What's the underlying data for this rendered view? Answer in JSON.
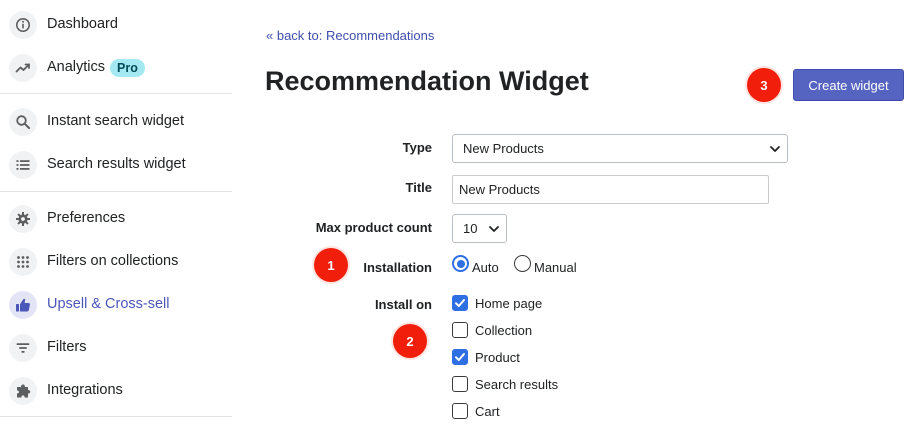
{
  "sidebar": {
    "items": [
      {
        "label": "Dashboard",
        "icon": "info-icon"
      },
      {
        "label": "Analytics",
        "icon": "trend-icon",
        "badge": "Pro"
      },
      {
        "label": "Instant search widget",
        "icon": "search-icon"
      },
      {
        "label": "Search results widget",
        "icon": "list-icon"
      },
      {
        "label": "Preferences",
        "icon": "gear-icon"
      },
      {
        "label": "Filters on collections",
        "icon": "grid-icon"
      },
      {
        "label": "Upsell & Cross-sell",
        "icon": "thumbs-up-icon",
        "active": true
      },
      {
        "label": "Filters",
        "icon": "filter-icon"
      },
      {
        "label": "Integrations",
        "icon": "puzzle-icon"
      }
    ]
  },
  "header": {
    "back_link": "« back to: Recommendations",
    "title": "Recommendation Widget",
    "create_button": "Create widget"
  },
  "form": {
    "type": {
      "label": "Type",
      "value": "New Products"
    },
    "title": {
      "label": "Title",
      "value": "New Products"
    },
    "max_count": {
      "label": "Max product count",
      "value": "10"
    },
    "installation": {
      "label": "Installation",
      "options": [
        {
          "label": "Auto",
          "checked": true
        },
        {
          "label": "Manual",
          "checked": false
        }
      ]
    },
    "install_on": {
      "label": "Install on",
      "options": [
        {
          "label": "Home page",
          "checked": true
        },
        {
          "label": "Collection",
          "checked": false
        },
        {
          "label": "Product",
          "checked": true
        },
        {
          "label": "Search results",
          "checked": false
        },
        {
          "label": "Cart",
          "checked": false
        }
      ]
    }
  },
  "markers": [
    "1",
    "2",
    "3"
  ],
  "colors": {
    "accent": "#5563c1",
    "active_nav": "#4a56b8",
    "checkbox": "#2f6fe4",
    "marker": "#f01e0a",
    "badge_bg": "#a4e8f2"
  }
}
